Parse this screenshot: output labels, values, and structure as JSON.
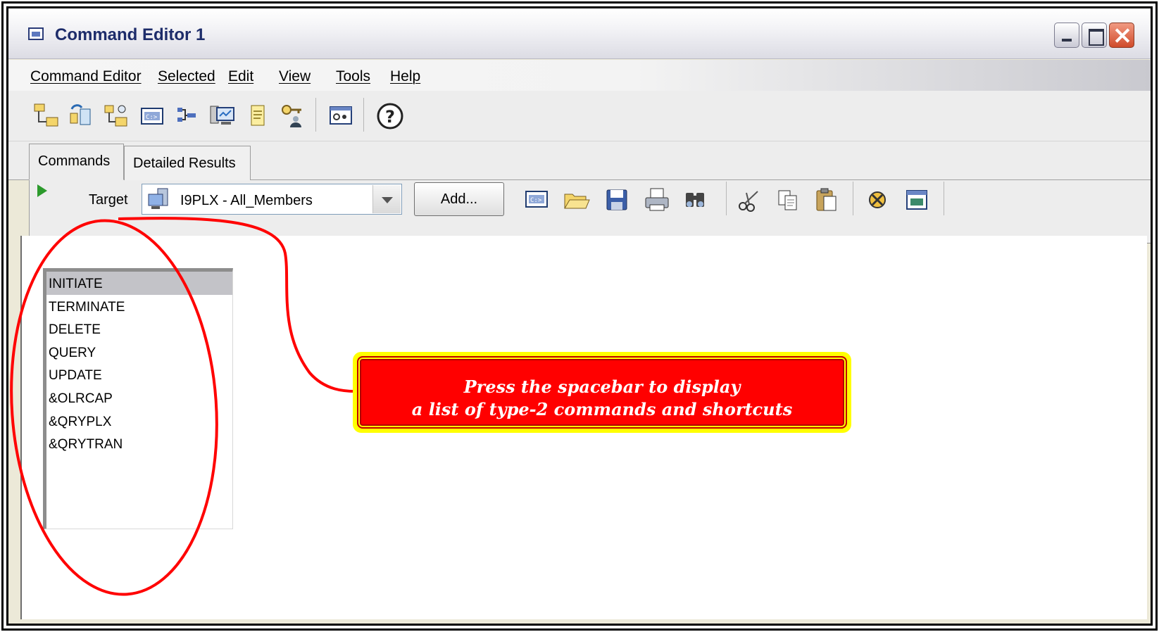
{
  "window": {
    "title": "Command Editor 1"
  },
  "menu": {
    "items": [
      "Command Editor",
      "Selected",
      "Edit",
      "View",
      "Tools",
      "Help"
    ]
  },
  "toolbar": {
    "icons": [
      "open-folder-tree-icon",
      "refresh-tree-icon",
      "network-icon",
      "command-prompt-icon",
      "hierarchy-icon",
      "monitor-icon",
      "notepad-icon",
      "key-user-icon",
      "settings-panel-icon",
      "help-icon"
    ]
  },
  "tabs": [
    "Commands",
    "Detailed Results"
  ],
  "command_toolbar": {
    "target_label": "Target",
    "target_value": "I9PLX - All_Members",
    "add_button": "Add...",
    "icons": [
      "run-icon",
      "command-prompt-icon",
      "open-icon",
      "save-icon",
      "print-icon",
      "find-icon",
      "cut-icon",
      "copy-icon",
      "paste-icon",
      "clear-icon",
      "window-icon"
    ]
  },
  "command_list": {
    "items": [
      "INITIATE",
      "TERMINATE",
      "DELETE",
      "QUERY",
      "UPDATE",
      "&OLRCAP",
      "&QRYPLX",
      "&QRYTRAN"
    ],
    "selected": "INITIATE"
  },
  "annotation": {
    "line1": "Press the spacebar to display",
    "line2": "a list of type-2 commands and shortcuts"
  },
  "colors": {
    "callout_fill": "#ff0000",
    "callout_border": "#ffff00",
    "ellipse_stroke": "#ff0000"
  }
}
